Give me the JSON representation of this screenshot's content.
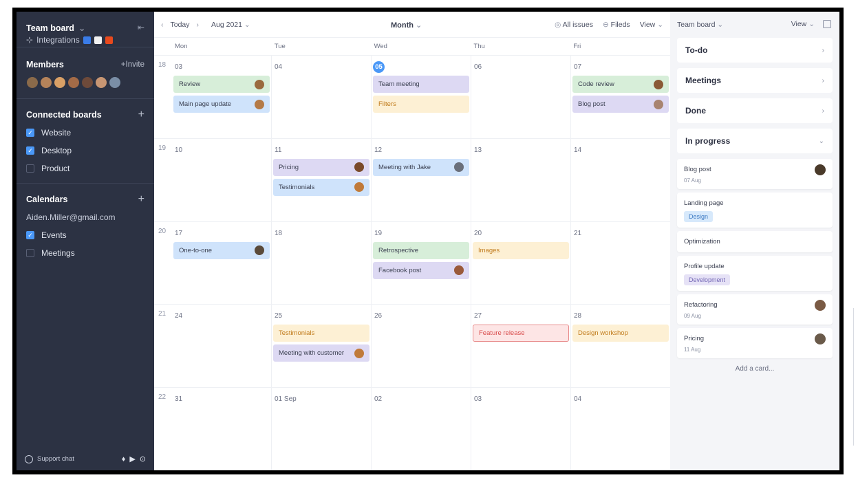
{
  "sidebar": {
    "team_name": "Team board",
    "collapse_icon": "collapse-icon",
    "integrations_label": "Integrations",
    "members": {
      "title": "Members",
      "invite": "+Invite",
      "avatar_colors": [
        "#8a6a4a",
        "#b5835a",
        "#d9a066",
        "#a46b47",
        "#6e4a3a",
        "#c89673",
        "#7a8ea6"
      ]
    },
    "connected_boards": {
      "title": "Connected boards",
      "items": [
        {
          "label": "Website",
          "checked": true
        },
        {
          "label": "Desktop",
          "checked": true
        },
        {
          "label": "Product",
          "checked": false
        }
      ]
    },
    "calendars": {
      "title": "Calendars",
      "email": "Aiden.Miller@gmail.com",
      "items": [
        {
          "label": "Events",
          "checked": true
        },
        {
          "label": "Meetings",
          "checked": false
        }
      ]
    },
    "support_chat": "Support chat"
  },
  "toolbar": {
    "today": "Today",
    "month_label": "Aug 2021",
    "view_mode": "Month",
    "all_issues": "All issues",
    "fields": "Fileds",
    "view": "View"
  },
  "calendar": {
    "day_headers": [
      "Mon",
      "Tue",
      "Wed",
      "Thu",
      "Fri"
    ],
    "weeks": [
      {
        "num": "18",
        "days": [
          {
            "date": "03",
            "events": [
              {
                "label": "Review",
                "color": "green",
                "avatar": "#9a6a3e"
              },
              {
                "label": "Main page update",
                "color": "blue",
                "avatar": "#b47a47"
              }
            ]
          },
          {
            "date": "04",
            "events": []
          },
          {
            "date": "05",
            "today": true,
            "events": [
              {
                "label": "Team meeting",
                "color": "purple"
              },
              {
                "label": "Filters",
                "color": "yellow"
              }
            ]
          },
          {
            "date": "06",
            "events": []
          },
          {
            "date": "07",
            "events": [
              {
                "label": "Code review",
                "color": "green",
                "avatar": "#8a5a36"
              },
              {
                "label": "Blog post",
                "color": "purple",
                "avatar": "#a88470"
              }
            ]
          }
        ]
      },
      {
        "num": "19",
        "days": [
          {
            "date": "10",
            "events": []
          },
          {
            "date": "11",
            "events": [
              {
                "label": "Pricing",
                "color": "purple",
                "avatar": "#7a4a2a"
              },
              {
                "label": "Testimonials",
                "color": "blue",
                "avatar": "#c07a3a"
              }
            ]
          },
          {
            "date": "12",
            "events": [
              {
                "label": "Meeting with Jake",
                "color": "blue",
                "avatar": "#6a6f7a"
              }
            ]
          },
          {
            "date": "13",
            "events": []
          },
          {
            "date": "14",
            "events": []
          }
        ]
      },
      {
        "num": "20",
        "days": [
          {
            "date": "17",
            "events": [
              {
                "label": "One-to-one",
                "color": "blue",
                "avatar": "#5a4a3a"
              }
            ]
          },
          {
            "date": "18",
            "events": []
          },
          {
            "date": "19",
            "events": [
              {
                "label": "Retrospective",
                "color": "green"
              },
              {
                "label": "Facebook post",
                "color": "purple",
                "avatar": "#9a5a3a"
              }
            ]
          },
          {
            "date": "20",
            "events": [
              {
                "label": "Images",
                "color": "yellow"
              }
            ]
          },
          {
            "date": "21",
            "events": []
          }
        ]
      },
      {
        "num": "21",
        "days": [
          {
            "date": "24",
            "events": []
          },
          {
            "date": "25",
            "events": [
              {
                "label": "Testimonials",
                "color": "yellow"
              },
              {
                "label": "Meeting with customer",
                "color": "purple",
                "avatar": "#c07a3a"
              }
            ]
          },
          {
            "date": "26",
            "events": []
          },
          {
            "date": "27",
            "events": [
              {
                "label": "Feature release",
                "color": "red"
              }
            ]
          },
          {
            "date": "28",
            "events": [
              {
                "label": "Design workshop",
                "color": "yellow"
              }
            ]
          }
        ]
      },
      {
        "num": "22",
        "days": [
          {
            "date": "31",
            "events": []
          },
          {
            "date": "01 Sep",
            "events": []
          },
          {
            "date": "02",
            "events": []
          },
          {
            "date": "03",
            "events": []
          },
          {
            "date": "04",
            "events": []
          }
        ]
      }
    ]
  },
  "panel": {
    "title": "Team board",
    "view": "View",
    "groups": [
      {
        "label": "To-do",
        "chevron": "›"
      },
      {
        "label": "Meetings",
        "chevron": "›"
      },
      {
        "label": "Done",
        "chevron": "›"
      },
      {
        "label": "In progress",
        "chevron": "⌄"
      }
    ],
    "cards": [
      {
        "title": "Blog post",
        "sub": "07 Aug",
        "avatar": "#4a3a2a"
      },
      {
        "title": "Landing page",
        "tag": "Design",
        "tag_class": "design"
      },
      {
        "title": "Optimization"
      },
      {
        "title": "Profile update",
        "tag": "Development",
        "tag_class": "dev"
      },
      {
        "title": "Refactoring",
        "sub": "09 Aug",
        "avatar": "#7a5a44"
      },
      {
        "title": "Pricing",
        "sub": "11 Aug",
        "avatar": "#6a5a4a"
      }
    ],
    "add_card": "Add a card..."
  }
}
